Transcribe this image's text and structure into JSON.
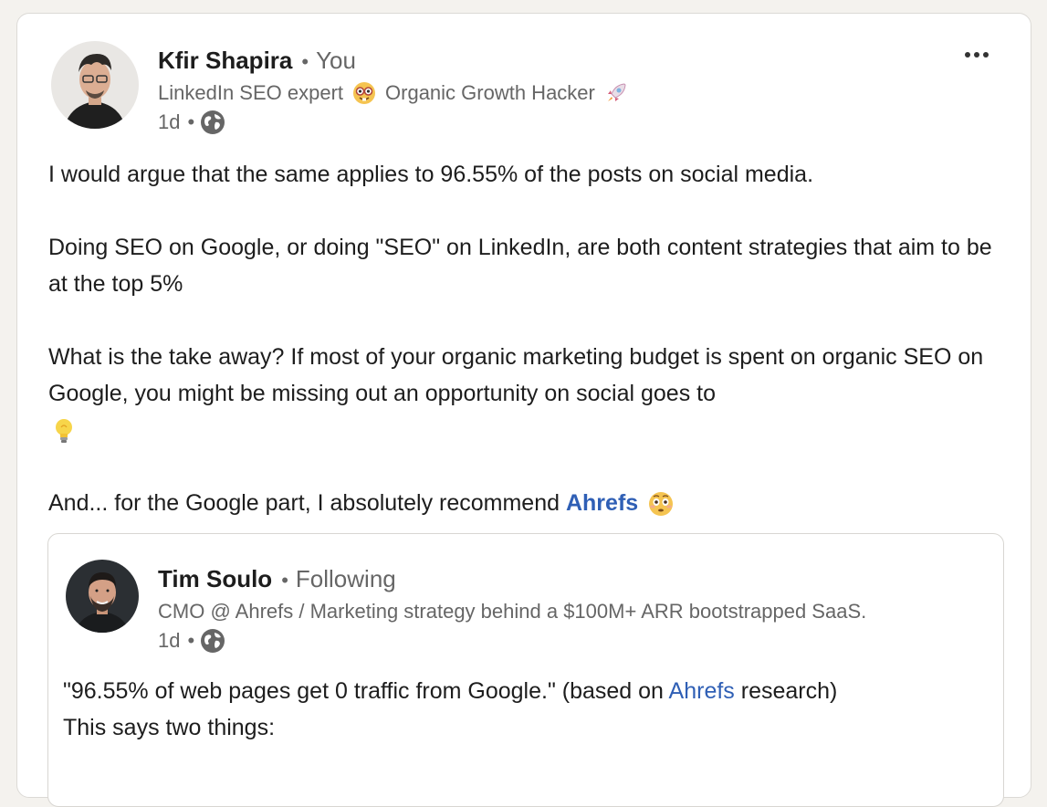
{
  "post": {
    "author_name": "Kfir Shapira",
    "bullet": "•",
    "relation": "You",
    "headline_part1": "LinkedIn SEO expert",
    "headline_part2": "Organic Growth Hacker",
    "time": "1d",
    "time_sep": "•",
    "more_label": "•••",
    "paragraph1": "I would argue that the same applies to 96.55% of the posts on social media.",
    "paragraph2": "Doing SEO on Google, or doing \"SEO\" on LinkedIn, are both content strategies that aim to be at the top 5%",
    "paragraph3": "What is the take away? If most of your organic marketing budget is spent on organic SEO on Google, you might be missing out an opportunity on social goes to",
    "paragraph4_prefix": "And... for the Google part, I absolutely recommend",
    "mention": "Ahrefs"
  },
  "quoted_post": {
    "author_name": "Tim Soulo",
    "bullet": "•",
    "relation": "Following",
    "headline": "CMO @ Ahrefs / Marketing strategy behind a $100M+ ARR bootstrapped SaaS.",
    "time": "1d",
    "time_sep": "•",
    "line1_prefix": "\"96.55% of web pages get 0 traffic from Google.\" (based on",
    "mention": "Ahrefs",
    "line1_suffix": "research)",
    "line2": "This says two things:"
  },
  "icons": {
    "globe": "globe-icon",
    "more": "more-horizontal-icon",
    "nerd": "nerd-face-emoji",
    "rocket": "rocket-emoji",
    "bulb": "light-bulb-emoji",
    "flushed": "flushed-face-emoji"
  },
  "colors": {
    "link": "#2f5fb5",
    "secondary": "#666666",
    "background": "#f4f2ee"
  }
}
